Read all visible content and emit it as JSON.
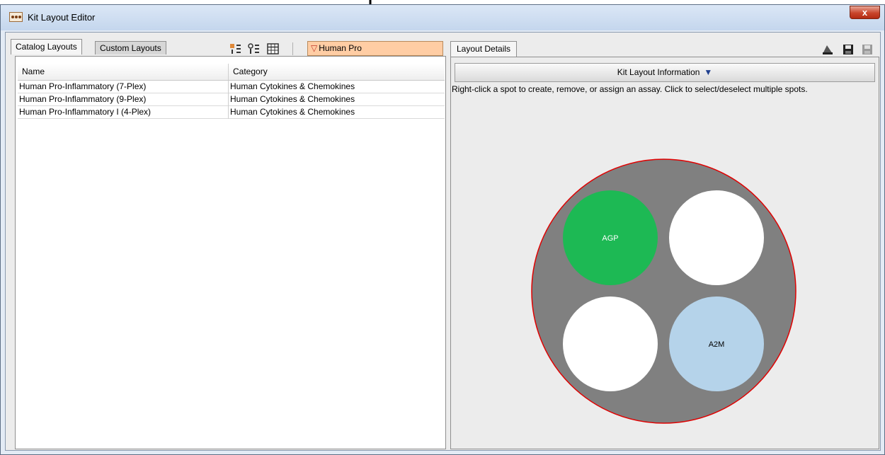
{
  "window": {
    "title": "Kit Layout Editor",
    "close_label": "x"
  },
  "left": {
    "tabs": [
      {
        "label": "Catalog Layouts"
      },
      {
        "label": "Custom Layouts"
      }
    ],
    "filter_text": "Human Pro",
    "table": {
      "headers": [
        "Name",
        "Category"
      ],
      "rows": [
        [
          "Human Pro-Inflammatory (7-Plex)",
          "Human Cytokines & Chemokines"
        ],
        [
          "Human Pro-Inflammatory (9-Plex)",
          "Human Cytokines & Chemokines"
        ],
        [
          "Human Pro-Inflammatory I (4-Plex)",
          "Human Cytokines & Chemokines"
        ]
      ]
    }
  },
  "right": {
    "tab_label": "Layout Details",
    "info_button": "Kit Layout Information",
    "hint": "Right-click a spot to create, remove, or assign an assay. Click to select/deselect multiple spots.",
    "spots": [
      {
        "label": "AGP",
        "color": "#1db954"
      },
      {
        "label": "",
        "color": "#ffffff"
      },
      {
        "label": "",
        "color": "#ffffff"
      },
      {
        "label": "A2M",
        "color": "#b5d3ea"
      }
    ]
  },
  "colors": {
    "well": "#808080",
    "well_border": "#e00000",
    "filter_bg": "#ffcda4"
  }
}
